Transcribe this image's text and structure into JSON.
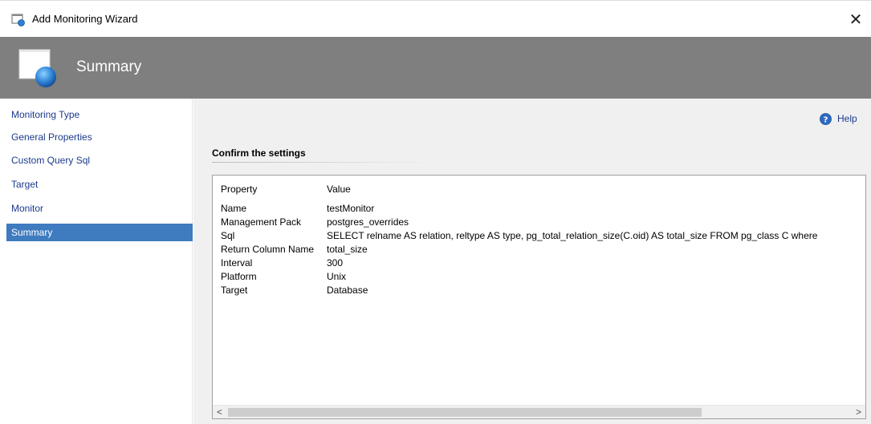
{
  "window": {
    "title": "Add Monitoring Wizard",
    "close_glyph": "✕",
    "app_icon": "wizard-window-icon"
  },
  "banner": {
    "title": "Summary",
    "icon": "wizard-page-icon",
    "background": "#7f7f7f"
  },
  "nav": {
    "items": [
      {
        "label": "Monitoring Type"
      },
      {
        "label": "General Properties"
      },
      {
        "label": "Custom Query Sql"
      },
      {
        "label": "Target"
      },
      {
        "label": "Monitor"
      },
      {
        "label": "Summary",
        "selected": true
      }
    ],
    "selected_color": "#3f7bbf"
  },
  "help": {
    "label": "Help",
    "icon": "help-icon"
  },
  "summary": {
    "heading": "Confirm the settings",
    "columns": {
      "property": "Property",
      "value": "Value"
    },
    "rows": [
      {
        "property": "Name",
        "value": "testMonitor"
      },
      {
        "property": "Management Pack",
        "value": "postgres_overrides"
      },
      {
        "property": "Sql",
        "value": "SELECT relname AS relation, reltype AS type, pg_total_relation_size(C.oid) AS total_size FROM pg_class C where"
      },
      {
        "property": "Return Column Name",
        "value": "total_size"
      },
      {
        "property": "Interval",
        "value": "300"
      },
      {
        "property": "Platform",
        "value": "Unix"
      },
      {
        "property": "Target",
        "value": "Database"
      }
    ]
  },
  "scrollbar": {
    "left_arrow": "<",
    "right_arrow": ">"
  }
}
